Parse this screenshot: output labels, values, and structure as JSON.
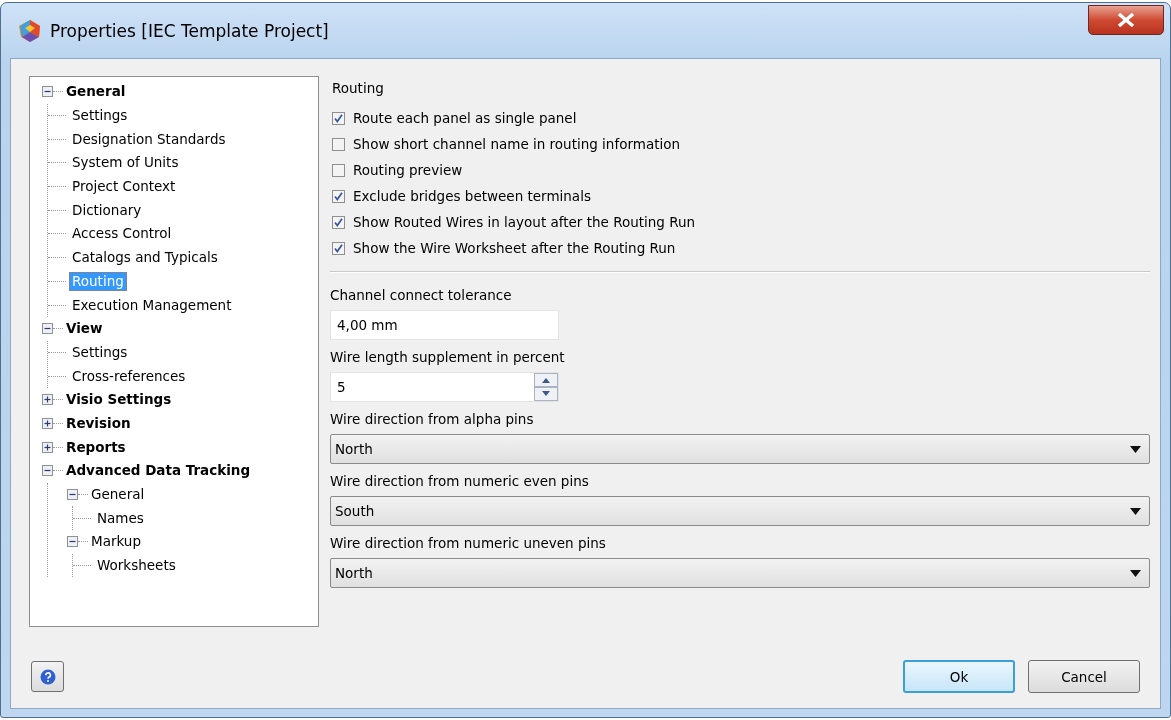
{
  "window": {
    "title": "Properties [IEC Template Project]"
  },
  "tree": [
    {
      "label": "General",
      "expanded": true,
      "selected": false,
      "children": [
        {
          "label": "Settings",
          "selected": false
        },
        {
          "label": "Designation Standards",
          "selected": false
        },
        {
          "label": "System of Units",
          "selected": false
        },
        {
          "label": "Project Context",
          "selected": false
        },
        {
          "label": "Dictionary",
          "selected": false
        },
        {
          "label": "Access Control",
          "selected": false
        },
        {
          "label": "Catalogs and Typicals",
          "selected": false
        },
        {
          "label": "Routing",
          "selected": true
        },
        {
          "label": "Execution Management",
          "selected": false
        }
      ]
    },
    {
      "label": "View",
      "expanded": true,
      "selected": false,
      "children": [
        {
          "label": "Settings",
          "selected": false
        },
        {
          "label": "Cross-references",
          "selected": false
        }
      ]
    },
    {
      "label": "Visio Settings",
      "expanded": false,
      "selected": false
    },
    {
      "label": "Revision",
      "expanded": false,
      "selected": false
    },
    {
      "label": "Reports",
      "expanded": false,
      "selected": false
    },
    {
      "label": "Advanced Data Tracking",
      "expanded": true,
      "selected": false,
      "children": [
        {
          "label": "General",
          "expanded": true,
          "selected": false,
          "children": [
            {
              "label": "Names",
              "selected": false
            }
          ]
        },
        {
          "label": "Markup",
          "expanded": true,
          "selected": false,
          "children": [
            {
              "label": "Worksheets",
              "selected": false
            }
          ]
        }
      ]
    }
  ],
  "routing": {
    "title": "Routing",
    "options": [
      {
        "label": "Route each panel as single panel",
        "checked": true
      },
      {
        "label": "Show short channel name in routing information",
        "checked": false
      },
      {
        "label": "Routing preview",
        "checked": false
      },
      {
        "label": "Exclude bridges between terminals",
        "checked": true
      },
      {
        "label": "Show Routed Wires in layout after the Routing Run",
        "checked": true
      },
      {
        "label": "Show the Wire Worksheet after the Routing Run",
        "checked": true
      }
    ]
  },
  "fields": [
    {
      "kind": "text",
      "label": "Channel connect tolerance",
      "value": "4,00 mm"
    },
    {
      "kind": "spin",
      "label": "Wire length supplement in percent",
      "value": "5"
    },
    {
      "kind": "select",
      "label": "Wire direction from alpha pins",
      "value": "North"
    },
    {
      "kind": "select",
      "label": "Wire direction from numeric even pins",
      "value": "South"
    },
    {
      "kind": "select",
      "label": "Wire direction from numeric uneven pins",
      "value": "North"
    }
  ],
  "buttons": [
    {
      "label": "Ok",
      "default": true
    },
    {
      "label": "Cancel",
      "default": false
    }
  ]
}
